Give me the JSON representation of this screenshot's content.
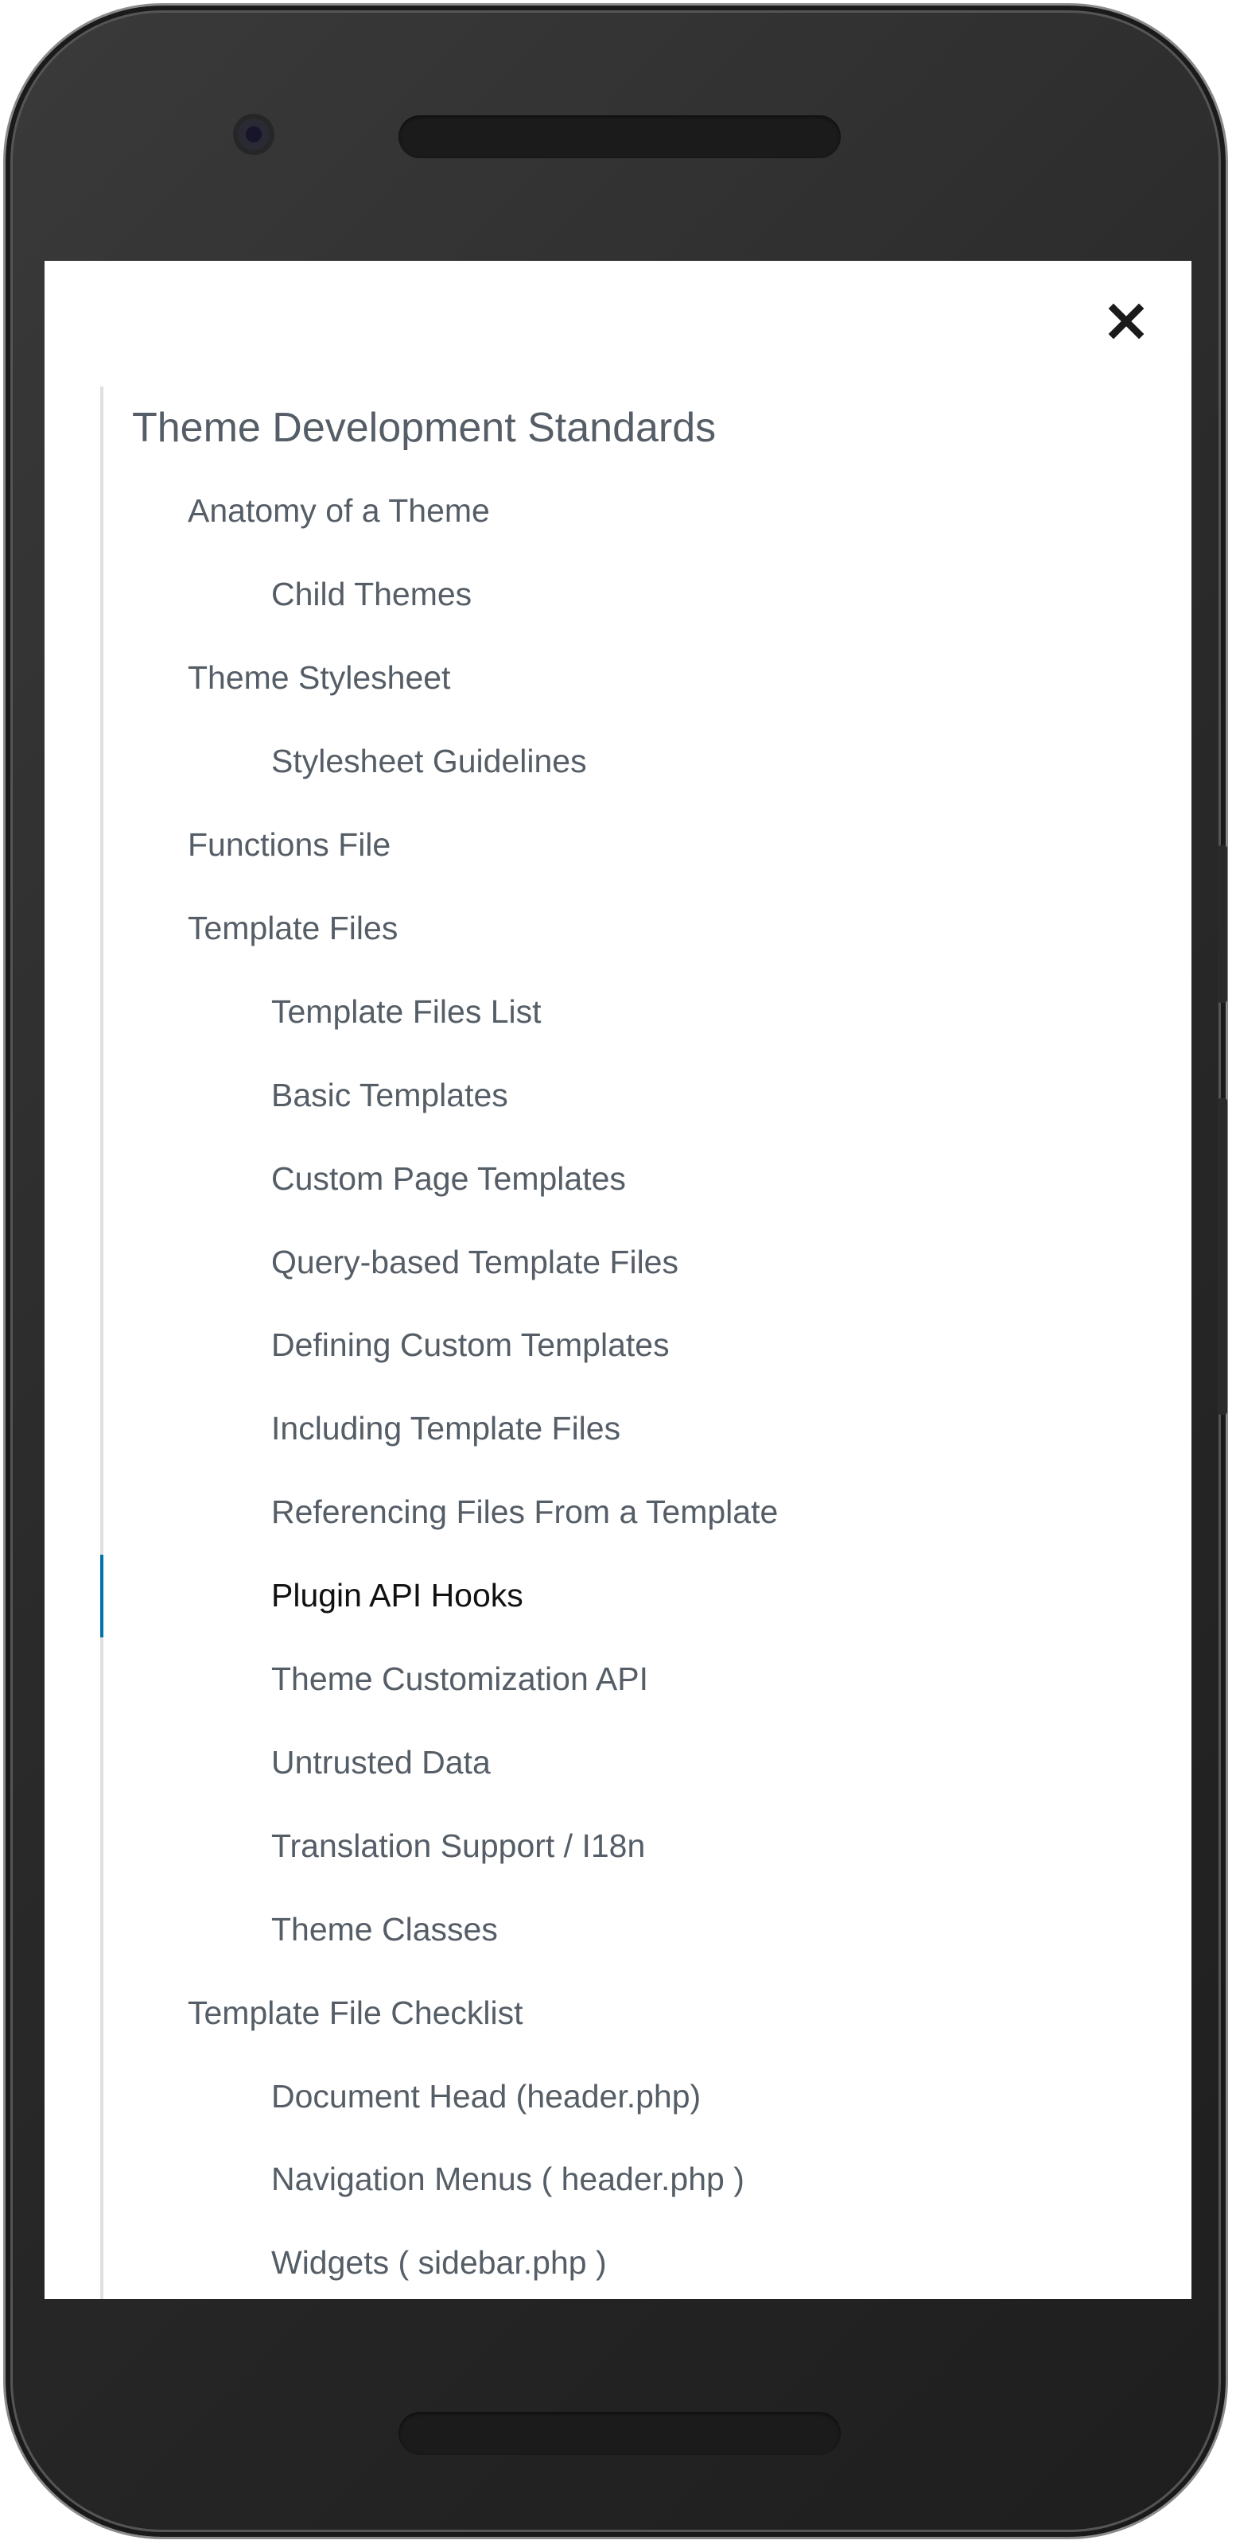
{
  "panel": {
    "close_icon": "close-icon",
    "toc": [
      {
        "label": "Theme Development Standards",
        "level": 0
      },
      {
        "label": "Anatomy of a Theme",
        "level": 1
      },
      {
        "label": "Child Themes",
        "level": 2
      },
      {
        "label": "Theme Stylesheet",
        "level": 1
      },
      {
        "label": "Stylesheet Guidelines",
        "level": 2
      },
      {
        "label": "Functions File",
        "level": 1
      },
      {
        "label": "Template Files",
        "level": 1
      },
      {
        "label": "Template Files List",
        "level": 2
      },
      {
        "label": "Basic Templates",
        "level": 2
      },
      {
        "label": "Custom Page Templates",
        "level": 2
      },
      {
        "label": "Query-based Template Files",
        "level": 2
      },
      {
        "label": "Defining Custom Templates",
        "level": 2
      },
      {
        "label": "Including Template Files",
        "level": 2
      },
      {
        "label": "Referencing Files From a Template",
        "level": 2
      },
      {
        "label": "Plugin API Hooks",
        "level": 2,
        "active": true
      },
      {
        "label": "Theme Customization API",
        "level": 2
      },
      {
        "label": "Untrusted Data",
        "level": 2
      },
      {
        "label": "Translation Support / I18n",
        "level": 2
      },
      {
        "label": "Theme Classes",
        "level": 2
      },
      {
        "label": "Template File Checklist",
        "level": 1
      },
      {
        "label": "Document Head (header.php)",
        "level": 2
      },
      {
        "label": "Navigation Menus ( header.php )",
        "level": 2
      },
      {
        "label": "Widgets ( sidebar.php )",
        "level": 2
      }
    ]
  },
  "colors": {
    "text": "#555d66",
    "active_text": "#111111",
    "active_indicator": "#0073aa",
    "rail": "#e0e0e0"
  }
}
